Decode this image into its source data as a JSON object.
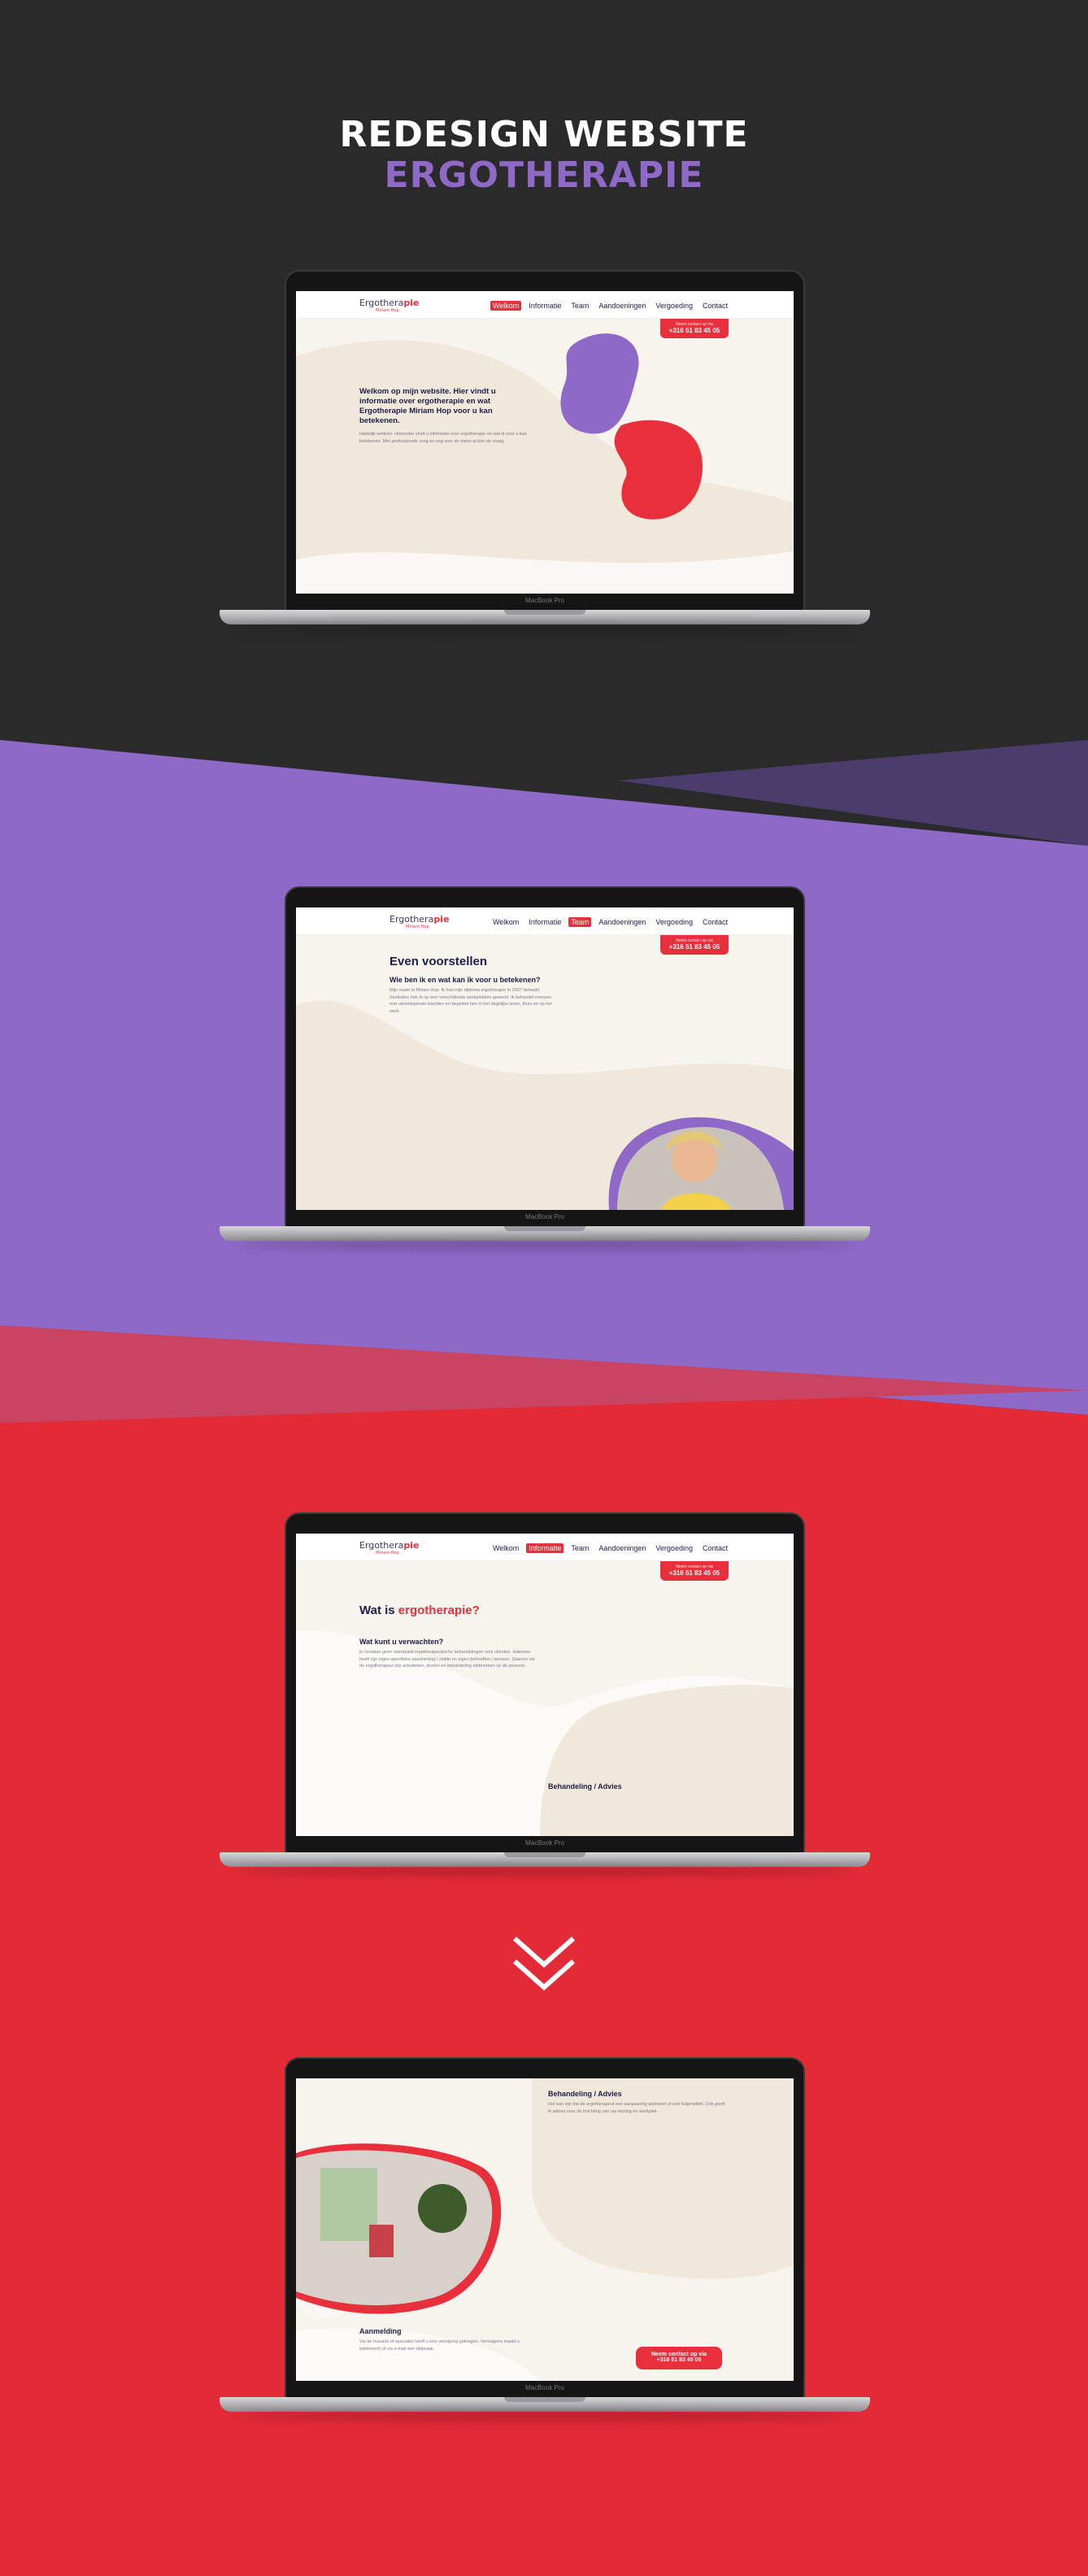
{
  "heading": {
    "line1": "REDESIGN WEBSITE",
    "line2": "ERGOTHERAPIE"
  },
  "colors": {
    "dark_bg": "#2a2a2b",
    "purple": "#8e69c8",
    "red": "#e8303d",
    "navy": "#1d1d4b",
    "cream": "#f7f4ee"
  },
  "laptop_brand": "MacBook Pro",
  "site": {
    "logo_main": "Ergothera",
    "logo_accent": "pie",
    "logo_sub": "Miriam Hop",
    "menu": [
      "Welkom",
      "Informatie",
      "Team",
      "Aandoeningen",
      "Vergoeding",
      "Contact"
    ],
    "cta_line1": "Neem contact op via",
    "cta_phone": "+316 51 83 45 05"
  },
  "screen1": {
    "title": "Welkom op mijn website. Hier vindt u informatie over ergotherapie en wat Ergotherapie Miriam Hop voor u kan betekenen.",
    "body": "Hartelijk welkom. Hieronder vindt u informatie over ergotherapie en wat ik voor u kan betekenen. Met professionele zorg en oog voor de mens achter de vraag."
  },
  "screen2": {
    "title": "Even voorstellen",
    "subtitle": "Wie ben ik en wat kan ik voor u betekenen?",
    "body": "Mijn naam is Miriam Hop. Ik heb mijn diploma ergotherapie in 2007 behaald. Sindsdien heb ik op veel verschillende werkplekken gewerkt. Ik behandel mensen met uiteenlopende klachten en begeleid hen in het dagelijks leven, thuis en op het werk."
  },
  "screen3": {
    "title_plain": "Wat is ",
    "title_accent": "ergotherapie?",
    "subtitle": "Wat kunt u verwachten?",
    "body": "Er bestaan geen standaard ergotherapeutische behandelingen voor cliënten. Iedereen heeft zijn eigen specifieke aandoening / ziekte en eigen behoeften / wensen. Daarom zal de ergotherapeut zijn activiteiten, doelen en behandeling afstemmen op de persoon.",
    "side_title": "Behandeling / Advies"
  },
  "screen4": {
    "side_title": "Behandeling / Advies",
    "side_body": "Het kan zijn dat de ergotherapeut een aanpassing adviseert of een hulpmiddel. Ook geeft ik advies over de inrichting van uw woning en werkplek.",
    "sub_title": "Aanmelding",
    "sub_body": "Via de huisarts of specialist heeft u een verwijzing gekregen. Vervolgens maakt u telefonisch of via e-mail een afspraak.",
    "cta_line1": "Neem contact op via",
    "cta_phone": "+316 51 83 45 05"
  }
}
